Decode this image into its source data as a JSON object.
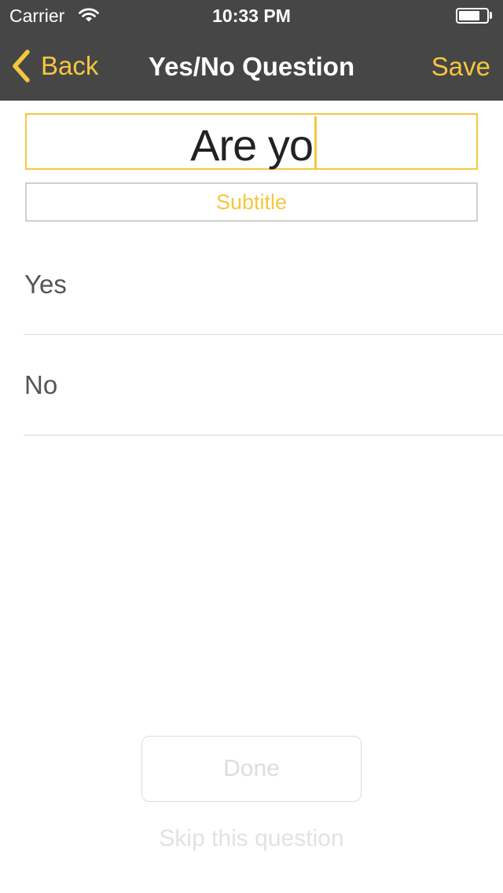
{
  "status_bar": {
    "carrier": "Carrier",
    "time": "10:33 PM",
    "battery_level": 0.75
  },
  "navbar": {
    "back_label": "Back",
    "title": "Yes/No Question",
    "save_label": "Save"
  },
  "question": {
    "title_value": "Are yo",
    "subtitle_placeholder": "Subtitle"
  },
  "options": [
    {
      "label": "Yes"
    },
    {
      "label": "No"
    }
  ],
  "footer": {
    "done_label": "Done",
    "skip_label": "Skip this question"
  },
  "colors": {
    "accent": "#f5c73e",
    "nav_background": "#464646",
    "disabled": "#dcdcdc"
  },
  "icons": {
    "back": "chevron-left-icon",
    "wifi": "wifi-icon",
    "battery": "battery-icon"
  }
}
